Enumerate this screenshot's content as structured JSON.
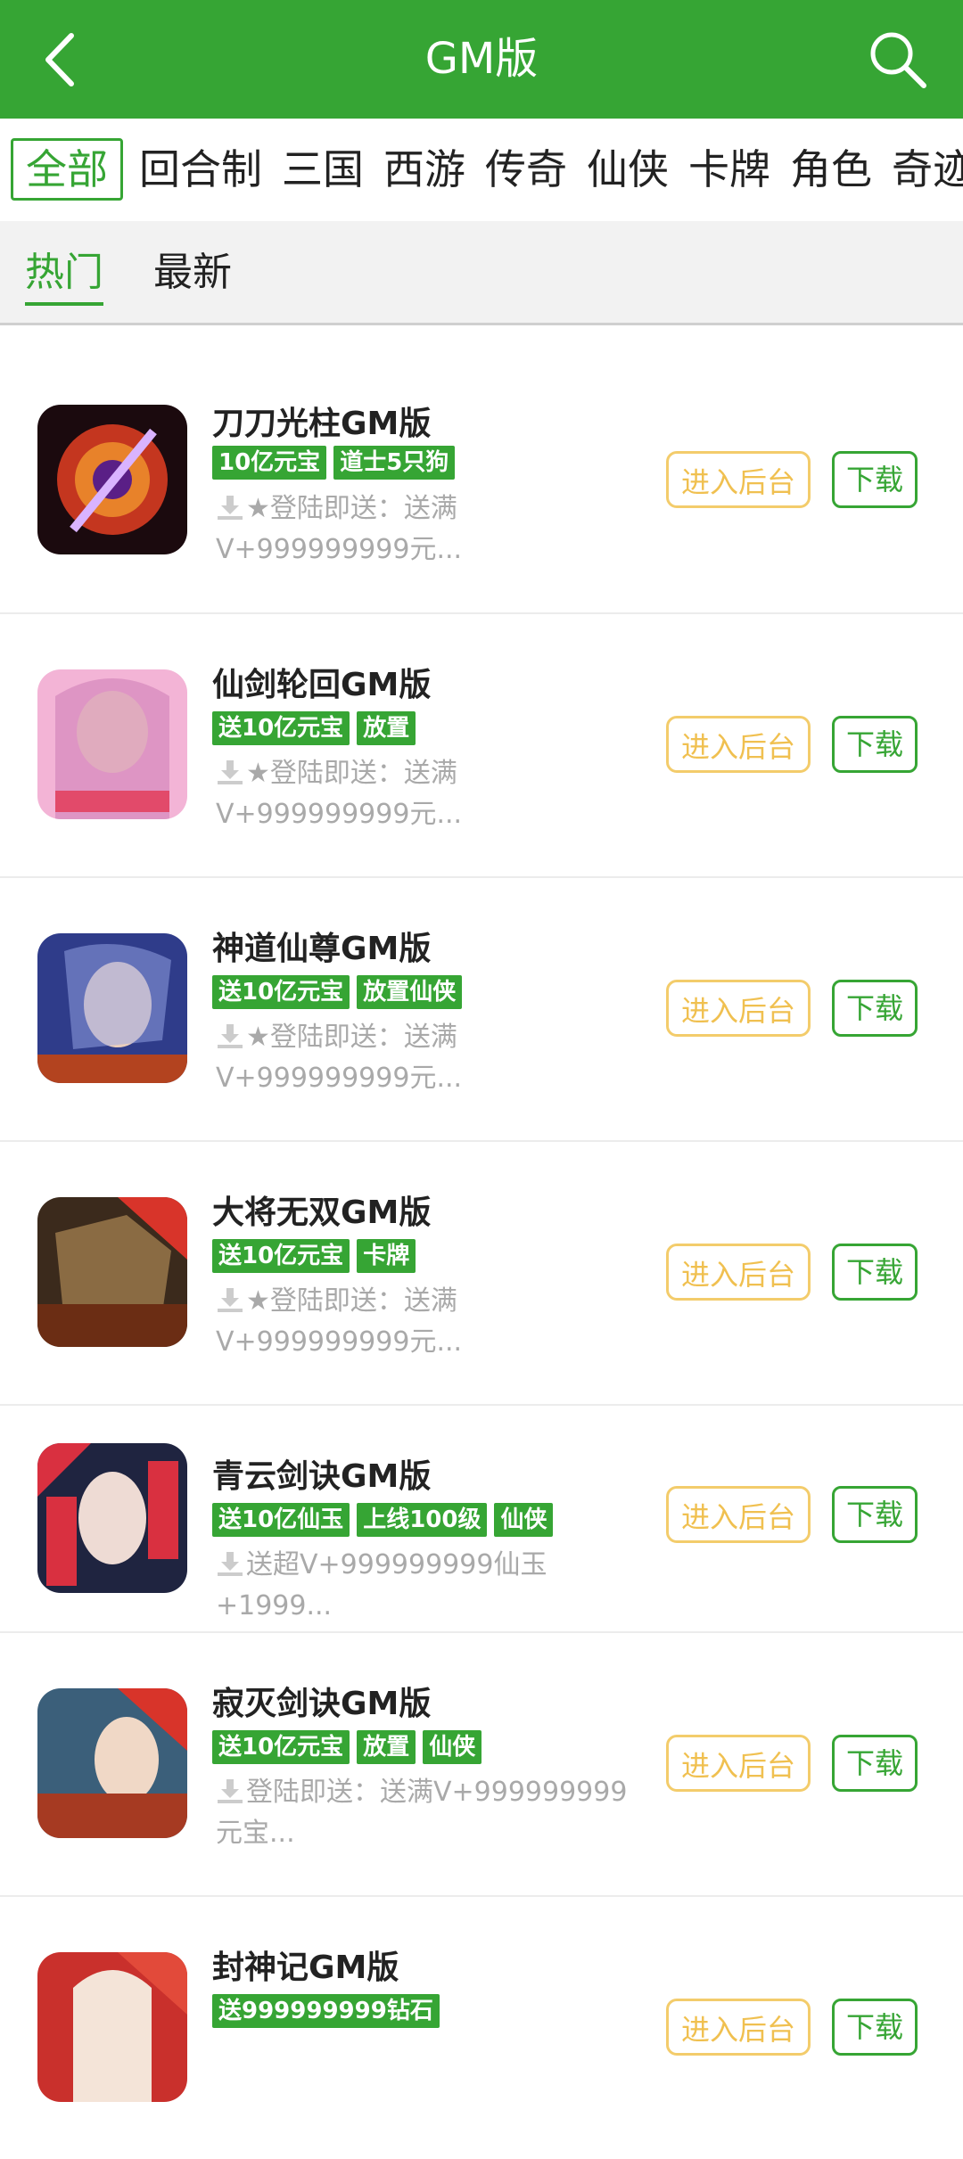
{
  "header": {
    "title": "GM版",
    "back_icon": "back-chevron-icon",
    "search_icon": "search-icon"
  },
  "categories": [
    "全部",
    "回合制",
    "三国",
    "西游",
    "传奇",
    "仙侠",
    "卡牌",
    "角色",
    "奇迹"
  ],
  "sort_tabs": [
    "热门",
    "最新"
  ],
  "buttons": {
    "admin": "进入后台",
    "download": "下载"
  },
  "colors": {
    "brand_green": "#36a534",
    "admin_yellow": "#f3cc6b",
    "desc_gray": "#a9a9a9"
  },
  "games": [
    {
      "name": "刀刀光柱GM版",
      "tags": [
        "10亿元宝",
        "道士5只狗"
      ],
      "desc": "★登陆即送：送满V+999999999元..."
    },
    {
      "name": "仙剑轮回GM版",
      "tags": [
        "送10亿元宝",
        "放置"
      ],
      "desc": "★登陆即送：送满V+999999999元..."
    },
    {
      "name": "神道仙尊GM版",
      "tags": [
        "送10亿元宝",
        "放置仙侠"
      ],
      "desc": "★登陆即送：送满V+999999999元..."
    },
    {
      "name": "大将无双GM版",
      "tags": [
        "送10亿元宝",
        "卡牌"
      ],
      "desc": "★登陆即送：送满V+999999999元..."
    },
    {
      "name": "青云剑诀GM版",
      "tags": [
        "送10亿仙玉",
        "上线100级",
        "仙侠"
      ],
      "desc": "送超V+999999999仙玉+1999..."
    },
    {
      "name": "寂灭剑诀GM版",
      "tags": [
        "送10亿元宝",
        "放置",
        "仙侠"
      ],
      "desc": "登陆即送：送满V+999999999元宝..."
    },
    {
      "name": "封神记GM版",
      "tags": [
        "送999999999钻石"
      ],
      "desc": ""
    }
  ]
}
